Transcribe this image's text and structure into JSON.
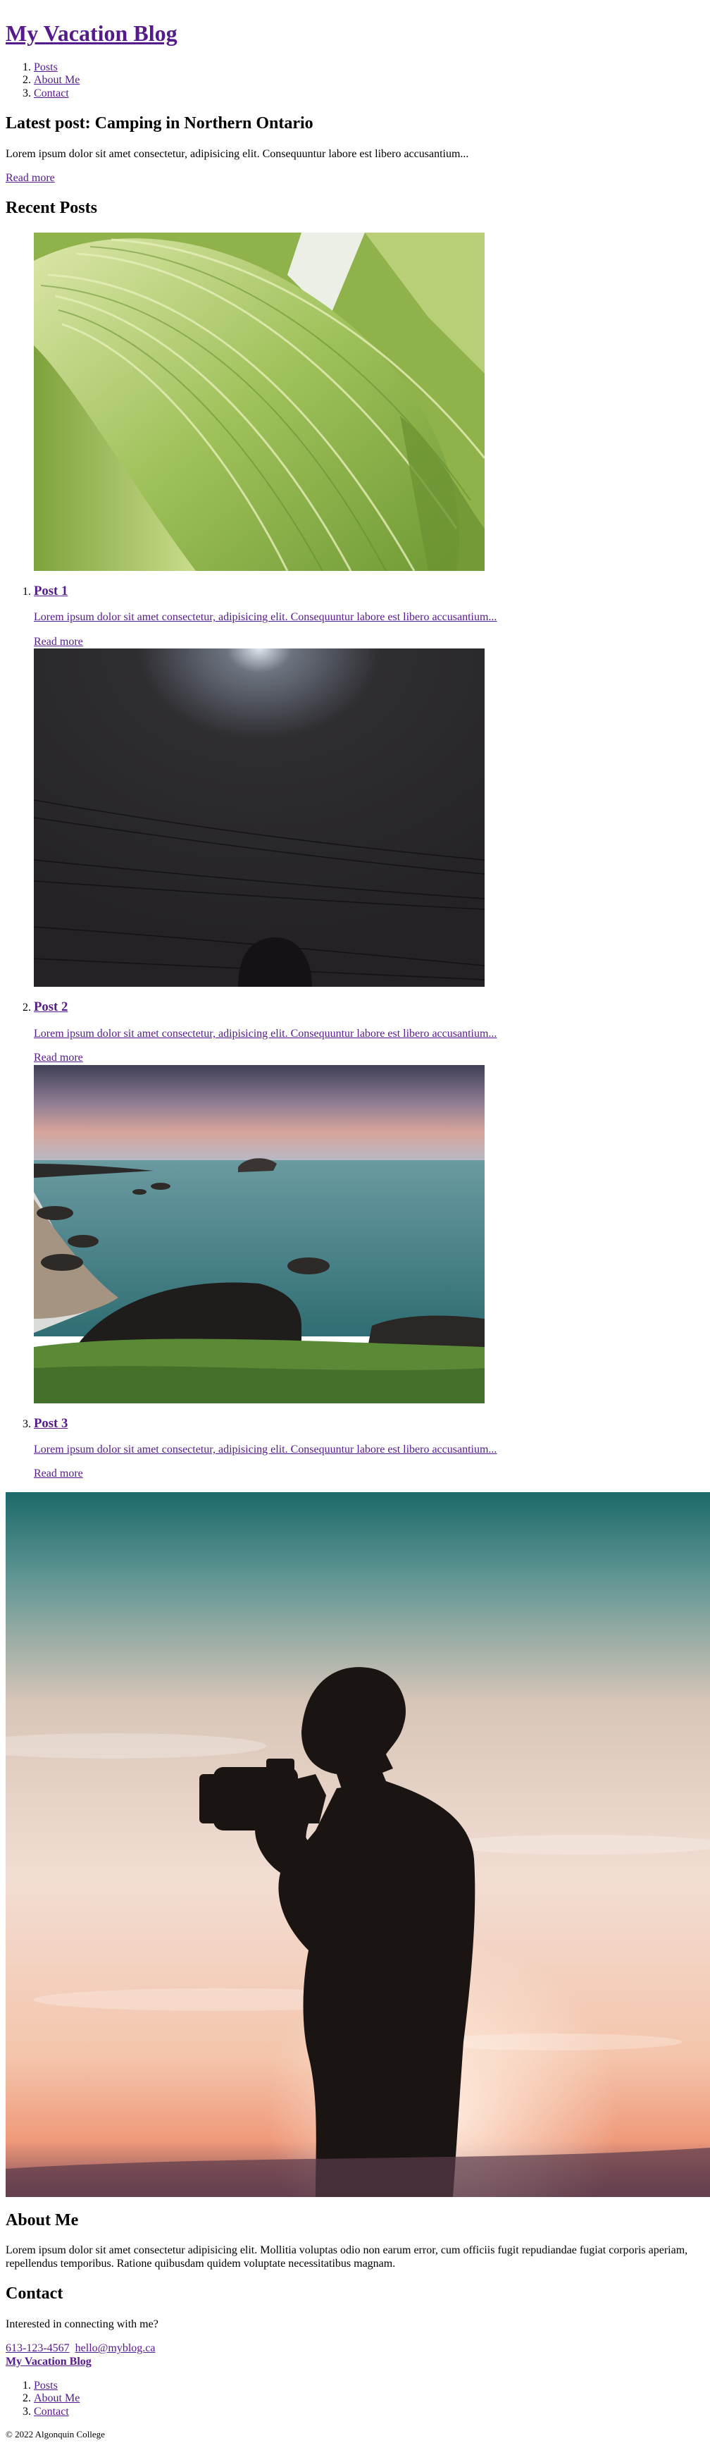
{
  "header": {
    "site_title": "My Vacation Blog",
    "nav": [
      {
        "label": "Posts"
      },
      {
        "label": "About Me"
      },
      {
        "label": "Contact"
      }
    ]
  },
  "featured": {
    "heading": "Latest post: Camping in Northern Ontario",
    "excerpt": "Lorem ipsum dolor sit amet consectetur, adipisicing elit. Consequuntur labore est libero accusantium...",
    "read_more": "Read more"
  },
  "recent": {
    "heading": "Recent Posts",
    "posts": [
      {
        "title": "Post 1",
        "excerpt": "Lorem ipsum dolor sit amet consectetur, adipisicing elit. Consequuntur labore est libero accusantium...",
        "read_more": "Read more",
        "image": "leaf-photo"
      },
      {
        "title": "Post 2",
        "excerpt": "Lorem ipsum dolor sit amet consectetur, adipisicing elit. Consequuntur labore est libero accusantium...",
        "read_more": "Read more",
        "image": "night-sky-photo"
      },
      {
        "title": "Post 3",
        "excerpt": "Lorem ipsum dolor sit amet consectetur, adipisicing elit. Consequuntur labore est libero accusantium...",
        "read_more": "Read more",
        "image": "coast-photo"
      }
    ]
  },
  "hero_image": "photographer-silhouette-photo",
  "about": {
    "heading": "About Me",
    "text": "Lorem ipsum dolor sit amet consectetur adipisicing elit. Mollitia voluptas odio non earum error, cum officiis fugit repudiandae fugiat corporis aperiam, repellendus temporibus. Ratione quibusdam quidem voluptate necessitatibus magnam."
  },
  "contact": {
    "heading": "Contact",
    "prompt": "Interested in connecting with me?",
    "phone": "613-123-4567",
    "email": "hello@myblog.ca"
  },
  "footer": {
    "site_title": "My Vacation Blog",
    "nav": [
      {
        "label": "Posts"
      },
      {
        "label": "About Me"
      },
      {
        "label": "Contact"
      }
    ],
    "copyright": "© 2022 Algonquin College"
  },
  "colors": {
    "link": "#551a8b",
    "text": "#000000",
    "background": "#ffffff"
  }
}
